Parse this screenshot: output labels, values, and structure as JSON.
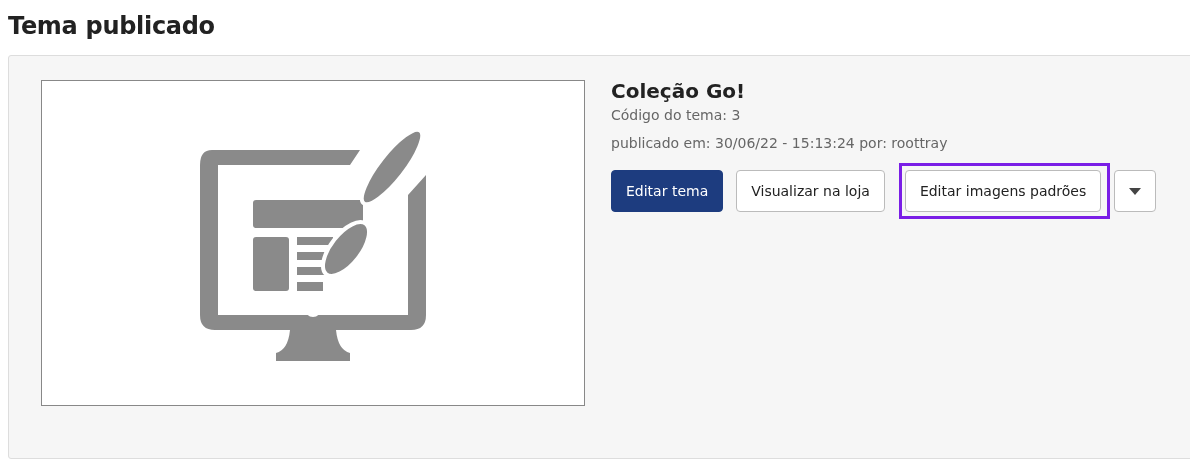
{
  "heading": "Tema publicado",
  "theme": {
    "preview": {
      "kind": "icon"
    },
    "name": "Coleção Go!",
    "code": "Código do tema: 3",
    "published": "publicado em: 30/06/22 - 15:13:24 por: roottray",
    "buttons": [
      {
        "kind": "primary",
        "label": "Editar tema",
        "highlighted": false
      },
      {
        "kind": "secondary",
        "label": "Visualizar na loja",
        "highlighted": false
      },
      {
        "kind": "secondary",
        "label": "Editar imagens padrões",
        "highlighted": true
      },
      {
        "kind": "dropdown",
        "highlighted": false
      }
    ]
  }
}
